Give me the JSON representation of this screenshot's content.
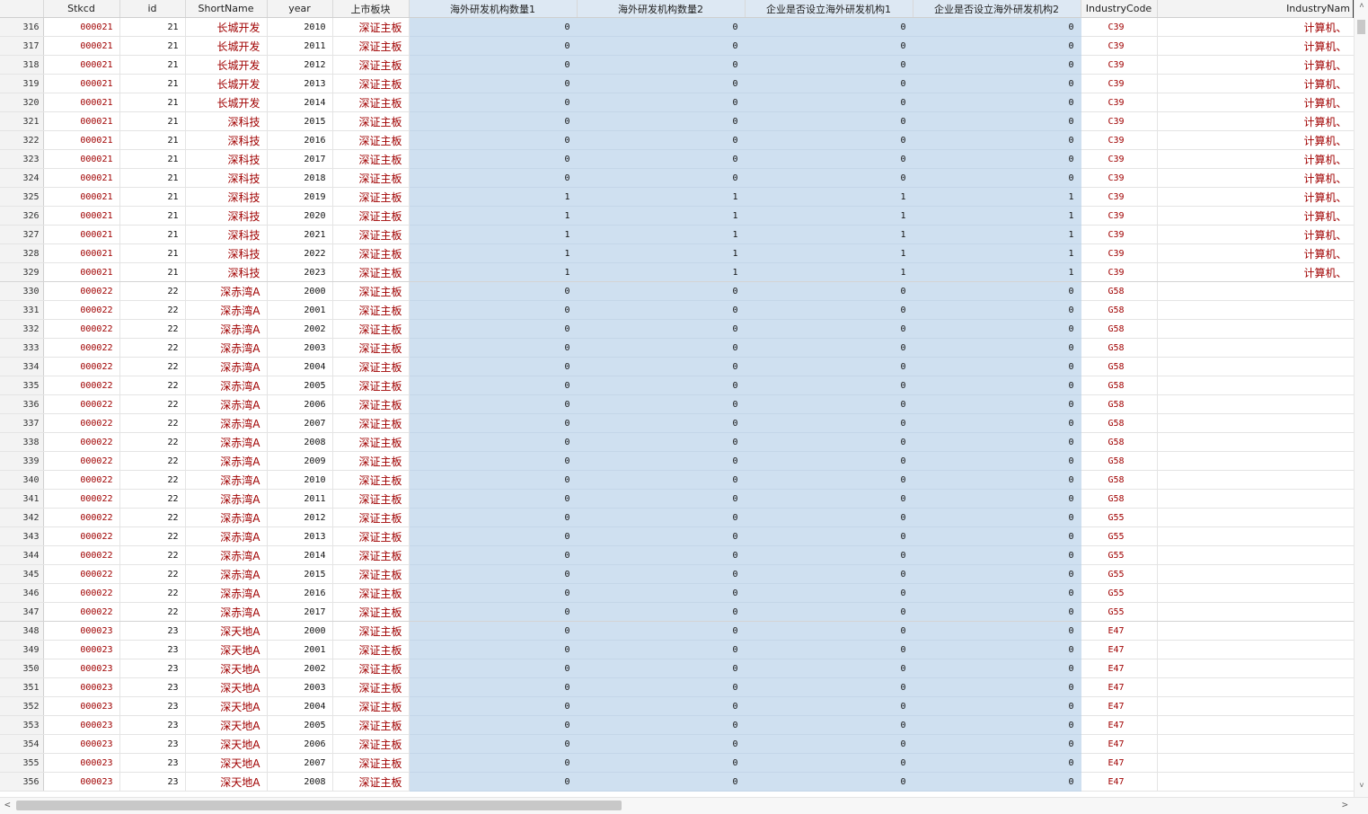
{
  "columns": [
    "",
    "Stkcd",
    "id",
    "ShortName",
    "year",
    "上市板块",
    "海外研发机构数量1",
    "海外研发机构数量2",
    "企业是否设立海外研发机构1",
    "企业是否设立海外研发机构2",
    "IndustryCode",
    "IndustryNam"
  ],
  "rows": [
    [
      "316",
      "000021",
      "21",
      "长城开发",
      "2010",
      "深证主板",
      "0",
      "0",
      "0",
      "0",
      "C39",
      "计算机、"
    ],
    [
      "317",
      "000021",
      "21",
      "长城开发",
      "2011",
      "深证主板",
      "0",
      "0",
      "0",
      "0",
      "C39",
      "计算机、"
    ],
    [
      "318",
      "000021",
      "21",
      "长城开发",
      "2012",
      "深证主板",
      "0",
      "0",
      "0",
      "0",
      "C39",
      "计算机、"
    ],
    [
      "319",
      "000021",
      "21",
      "长城开发",
      "2013",
      "深证主板",
      "0",
      "0",
      "0",
      "0",
      "C39",
      "计算机、"
    ],
    [
      "320",
      "000021",
      "21",
      "长城开发",
      "2014",
      "深证主板",
      "0",
      "0",
      "0",
      "0",
      "C39",
      "计算机、"
    ],
    [
      "321",
      "000021",
      "21",
      "深科技",
      "2015",
      "深证主板",
      "0",
      "0",
      "0",
      "0",
      "C39",
      "计算机、"
    ],
    [
      "322",
      "000021",
      "21",
      "深科技",
      "2016",
      "深证主板",
      "0",
      "0",
      "0",
      "0",
      "C39",
      "计算机、"
    ],
    [
      "323",
      "000021",
      "21",
      "深科技",
      "2017",
      "深证主板",
      "0",
      "0",
      "0",
      "0",
      "C39",
      "计算机、"
    ],
    [
      "324",
      "000021",
      "21",
      "深科技",
      "2018",
      "深证主板",
      "0",
      "0",
      "0",
      "0",
      "C39",
      "计算机、"
    ],
    [
      "325",
      "000021",
      "21",
      "深科技",
      "2019",
      "深证主板",
      "1",
      "1",
      "1",
      "1",
      "C39",
      "计算机、"
    ],
    [
      "326",
      "000021",
      "21",
      "深科技",
      "2020",
      "深证主板",
      "1",
      "1",
      "1",
      "1",
      "C39",
      "计算机、"
    ],
    [
      "327",
      "000021",
      "21",
      "深科技",
      "2021",
      "深证主板",
      "1",
      "1",
      "1",
      "1",
      "C39",
      "计算机、"
    ],
    [
      "328",
      "000021",
      "21",
      "深科技",
      "2022",
      "深证主板",
      "1",
      "1",
      "1",
      "1",
      "C39",
      "计算机、"
    ],
    [
      "329",
      "000021",
      "21",
      "深科技",
      "2023",
      "深证主板",
      "1",
      "1",
      "1",
      "1",
      "C39",
      "计算机、"
    ],
    [
      "330",
      "000022",
      "22",
      "深赤湾A",
      "2000",
      "深证主板",
      "0",
      "0",
      "0",
      "0",
      "G58",
      ""
    ],
    [
      "331",
      "000022",
      "22",
      "深赤湾A",
      "2001",
      "深证主板",
      "0",
      "0",
      "0",
      "0",
      "G58",
      ""
    ],
    [
      "332",
      "000022",
      "22",
      "深赤湾A",
      "2002",
      "深证主板",
      "0",
      "0",
      "0",
      "0",
      "G58",
      ""
    ],
    [
      "333",
      "000022",
      "22",
      "深赤湾A",
      "2003",
      "深证主板",
      "0",
      "0",
      "0",
      "0",
      "G58",
      ""
    ],
    [
      "334",
      "000022",
      "22",
      "深赤湾A",
      "2004",
      "深证主板",
      "0",
      "0",
      "0",
      "0",
      "G58",
      ""
    ],
    [
      "335",
      "000022",
      "22",
      "深赤湾A",
      "2005",
      "深证主板",
      "0",
      "0",
      "0",
      "0",
      "G58",
      ""
    ],
    [
      "336",
      "000022",
      "22",
      "深赤湾A",
      "2006",
      "深证主板",
      "0",
      "0",
      "0",
      "0",
      "G58",
      ""
    ],
    [
      "337",
      "000022",
      "22",
      "深赤湾A",
      "2007",
      "深证主板",
      "0",
      "0",
      "0",
      "0",
      "G58",
      ""
    ],
    [
      "338",
      "000022",
      "22",
      "深赤湾A",
      "2008",
      "深证主板",
      "0",
      "0",
      "0",
      "0",
      "G58",
      ""
    ],
    [
      "339",
      "000022",
      "22",
      "深赤湾A",
      "2009",
      "深证主板",
      "0",
      "0",
      "0",
      "0",
      "G58",
      ""
    ],
    [
      "340",
      "000022",
      "22",
      "深赤湾A",
      "2010",
      "深证主板",
      "0",
      "0",
      "0",
      "0",
      "G58",
      ""
    ],
    [
      "341",
      "000022",
      "22",
      "深赤湾A",
      "2011",
      "深证主板",
      "0",
      "0",
      "0",
      "0",
      "G58",
      ""
    ],
    [
      "342",
      "000022",
      "22",
      "深赤湾A",
      "2012",
      "深证主板",
      "0",
      "0",
      "0",
      "0",
      "G55",
      ""
    ],
    [
      "343",
      "000022",
      "22",
      "深赤湾A",
      "2013",
      "深证主板",
      "0",
      "0",
      "0",
      "0",
      "G55",
      ""
    ],
    [
      "344",
      "000022",
      "22",
      "深赤湾A",
      "2014",
      "深证主板",
      "0",
      "0",
      "0",
      "0",
      "G55",
      ""
    ],
    [
      "345",
      "000022",
      "22",
      "深赤湾A",
      "2015",
      "深证主板",
      "0",
      "0",
      "0",
      "0",
      "G55",
      ""
    ],
    [
      "346",
      "000022",
      "22",
      "深赤湾A",
      "2016",
      "深证主板",
      "0",
      "0",
      "0",
      "0",
      "G55",
      ""
    ],
    [
      "347",
      "000022",
      "22",
      "深赤湾A",
      "2017",
      "深证主板",
      "0",
      "0",
      "0",
      "0",
      "G55",
      ""
    ],
    [
      "348",
      "000023",
      "23",
      "深天地A",
      "2000",
      "深证主板",
      "0",
      "0",
      "0",
      "0",
      "E47",
      ""
    ],
    [
      "349",
      "000023",
      "23",
      "深天地A",
      "2001",
      "深证主板",
      "0",
      "0",
      "0",
      "0",
      "E47",
      ""
    ],
    [
      "350",
      "000023",
      "23",
      "深天地A",
      "2002",
      "深证主板",
      "0",
      "0",
      "0",
      "0",
      "E47",
      ""
    ],
    [
      "351",
      "000023",
      "23",
      "深天地A",
      "2003",
      "深证主板",
      "0",
      "0",
      "0",
      "0",
      "E47",
      ""
    ],
    [
      "352",
      "000023",
      "23",
      "深天地A",
      "2004",
      "深证主板",
      "0",
      "0",
      "0",
      "0",
      "E47",
      ""
    ],
    [
      "353",
      "000023",
      "23",
      "深天地A",
      "2005",
      "深证主板",
      "0",
      "0",
      "0",
      "0",
      "E47",
      ""
    ],
    [
      "354",
      "000023",
      "23",
      "深天地A",
      "2006",
      "深证主板",
      "0",
      "0",
      "0",
      "0",
      "E47",
      ""
    ],
    [
      "355",
      "000023",
      "23",
      "深天地A",
      "2007",
      "深证主板",
      "0",
      "0",
      "0",
      "0",
      "E47",
      ""
    ],
    [
      "356",
      "000023",
      "23",
      "深天地A",
      "2008",
      "深证主板",
      "0",
      "0",
      "0",
      "0",
      "E47",
      ""
    ]
  ],
  "colors": {
    "text_red": "#a00000",
    "selection": "#cfe0f0",
    "header_bg": "#f3f3f3"
  },
  "scrollbars": {
    "up_arrow": "˄",
    "down_arrow": "˅",
    "left_arrow": "<",
    "right_arrow": ">",
    "icons": [
      "scroll-up-icon",
      "scroll-down-icon",
      "scroll-left-icon",
      "scroll-right-icon"
    ]
  }
}
